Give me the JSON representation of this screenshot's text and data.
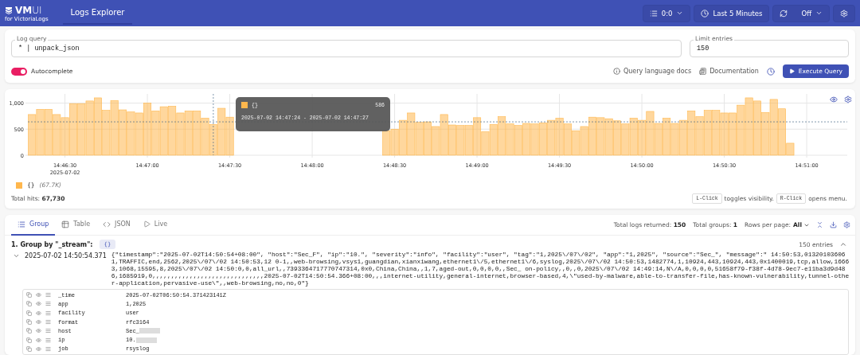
{
  "header": {
    "logo": {
      "name": "**VM**UI",
      "subtitle": "for VictoriaLogs"
    },
    "tabs": [
      {
        "label": "Logs Explorer",
        "selected": true
      }
    ],
    "controls": [
      {
        "kind": "tenant",
        "label": "0:0"
      },
      {
        "kind": "time",
        "label": "Last 5 Minutes"
      },
      {
        "kind": "refresh",
        "label": "Off"
      },
      {
        "kind": "settings"
      }
    ]
  },
  "query": {
    "label": "Log query",
    "value": "* | unpack_json",
    "limit_label": "Limit entries",
    "limit_value": "150",
    "autocomplete": {
      "label": "Autocomplete",
      "on": true
    },
    "links": [
      {
        "kind": "info",
        "label": "Query language docs"
      },
      {
        "kind": "docs",
        "label": "Documentation"
      },
      {
        "kind": "history"
      }
    ],
    "execute": "Execute Query"
  },
  "chart": {
    "chart_data": {
      "type": "bar",
      "grid": true,
      "categories": [
        null,
        null,
        null,
        null,
        "14:46:30",
        null,
        null,
        null,
        null,
        null,
        null,
        null,
        null,
        null,
        "14:47:00",
        null,
        null,
        null,
        null,
        null,
        null,
        null,
        null,
        null,
        "14:47:30",
        null,
        null,
        null,
        null,
        null,
        null,
        null,
        null,
        null,
        "14:48:00",
        null,
        null,
        null,
        null,
        null,
        null,
        null,
        null,
        null,
        "14:48:30",
        null,
        null,
        null,
        null,
        null,
        null,
        null,
        null,
        null,
        "14:49:00",
        null,
        null,
        null,
        null,
        null,
        null,
        null,
        null,
        null,
        "14:49:30",
        null,
        null,
        null,
        null,
        null,
        null,
        null,
        null,
        null,
        "14:50:00",
        null,
        null,
        null,
        null,
        null,
        null,
        null,
        null,
        null,
        "14:50:30",
        null,
        null,
        null,
        null,
        null,
        null,
        null,
        null,
        null,
        "14:51:00"
      ],
      "series": [
        {
          "name": "{}",
          "color": "#ffb74d",
          "values": [
            780,
            880,
            880,
            780,
            720,
            990,
            990,
            1040,
            1100,
            860,
            1050,
            870,
            830,
            810,
            1000,
            850,
            930,
            940,
            810,
            850,
            850,
            710,
            590,
            900,
            730,
            null,
            null,
            null,
            null,
            null,
            null,
            null,
            null,
            null,
            null,
            null,
            null,
            null,
            null,
            null,
            null,
            null,
            null,
            470,
            500,
            670,
            810,
            630,
            640,
            550,
            780,
            580,
            570,
            570,
            720,
            450,
            590,
            740,
            600,
            570,
            610,
            600,
            620,
            670,
            710,
            600,
            470,
            550,
            730,
            720,
            700,
            660,
            600,
            710,
            670,
            840,
            610,
            710,
            610,
            670,
            850,
            740,
            860,
            860,
            810,
            810,
            960,
            1100,
            1040,
            820,
            1070,
            890,
            230,
            null,
            null
          ]
        }
      ],
      "ref_lines": [
        {
          "axis": "y",
          "value": 640
        }
      ],
      "ylim": [
        0,
        1145
      ],
      "yticks": [
        0,
        500,
        {
          "value": 1000,
          "label": "1,000"
        }
      ]
    },
    "date_label": "2025-07-02",
    "tooltip": {
      "series": "{}",
      "value": "586",
      "range": "2025-07-02 14:47:24 - 2025-07-02 14:47:27"
    },
    "legend": [
      {
        "count": "(67.7K)"
      }
    ],
    "total_label": "Total hits:",
    "total": "67,730",
    "hints": [
      {
        "key": "L-Click",
        "text": "toggles visibility."
      },
      {
        "key": "R-Click",
        "text": "opens menu."
      }
    ]
  },
  "results": {
    "tabs": [
      {
        "label": "Group",
        "kind": "group",
        "selected": true
      },
      {
        "label": "Table",
        "kind": "table",
        "selected": false
      },
      {
        "label": "JSON",
        "kind": "json",
        "selected": false
      },
      {
        "label": "Live",
        "kind": "live",
        "selected": false
      }
    ],
    "stats": [
      "Total logs returned: **150**",
      "Total groups: **1**"
    ],
    "rows_per_page": {
      "label": "Rows per page:",
      "value": "All"
    },
    "groups": [
      {
        "title": "1. Group by \"_stream\":",
        "badge": "{}",
        "entries": "150 entries",
        "expanded": true,
        "logs": [
          {
            "time": "2025-07-02 14:50:54.371",
            "expanded": true,
            "message": "{\"timestamp\":\"2025-07-02T14:50:54+08:00\", \"host\":\"Sec_F\", \"ip\":\"10.\", \"severity\":\"info\", \"facility\":\"user\", \"tag\":\"1,2025\\/07\\/02\", \"app\":\"1,2025\", \"source\":\"Sec_\", \"message\":\" 14:50:53,013201036061,TRAFFIC,end,2562,2025\\/07\\/02 14:50:53,12 0-1,,web-browsing,vsys1,guangdian,xianxiwang,ethernet1\\/5,ethernet1\\/6,syslog,2025\\/07\\/02 14:50:53,1482774,1,10924,443,10924,443,0x1400019,tcp,allow,16663,1068,15595,8,2025\\/07\\/02 14:50:0,0,all_url,,7393364717770747314,0x0,China,China,,1,7,aged-out,0,0,0,0,,Sec_ on-policy,,0,,0,2025\\/07\\/02 14:49:14,N\\/A,0,0,0,0,51658f79-f38f-4d78-9ec7-e11ba3d9d486,1685919,0,,,,,,,,,,,,,,,,,,,,,,,,,,,,,,2025-07-02T14:50:54.366+08:00,,,internet-utility,general-internet,browser-based,4,\\\"used-by-malware,able-to-transfer-file,has-known-vulnerability,tunnel-other-application,pervasive-use\\\",,web-browsing,no,no,0\"}",
            "fields": [
              {
                "key": "_time",
                "value": "2025-07-02T06:50:54.371423141Z"
              },
              {
                "key": "app",
                "value": "1,2025"
              },
              {
                "key": "facility",
                "value": "user"
              },
              {
                "key": "format",
                "value": "rfc3164"
              },
              {
                "key": "host",
                "value": "Sec_",
                "redacted": true
              },
              {
                "key": "ip",
                "value": "10.",
                "redacted": true
              },
              {
                "key": "job",
                "value": "rsyslog"
              }
            ]
          }
        ]
      }
    ]
  }
}
